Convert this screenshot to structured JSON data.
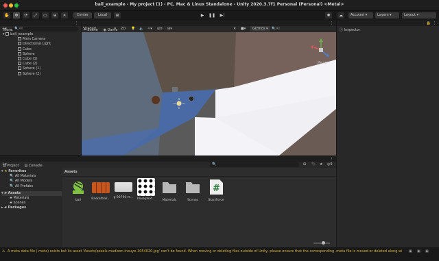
{
  "window": {
    "title": "ball_example - My project (1) - PC, Mac & Linux Standalone - Unity 2020.3.7f1 Personal (Personal) <Metal>"
  },
  "toolbar": {
    "center_label": "Center",
    "local_label": "Local",
    "account_label": "Account",
    "layers_label": "Layers",
    "layout_label": "Layout"
  },
  "hierarchy": {
    "tab": "Hierarchy",
    "search_placeholder": "All",
    "root": "ball_example",
    "items": [
      "Main Camera",
      "Directional Light",
      "Cube",
      "Sphere",
      "Cube (1)",
      "Cube (2)",
      "Sphere (1)",
      "Sphere (2)"
    ]
  },
  "scene": {
    "tab_scene": "Scene",
    "tab_game": "Game",
    "shading": "Shaded",
    "mode_2d": "2D",
    "gizmos": "Gizmos",
    "fx_count": "0",
    "gizmo_label": "Persp",
    "search_placeholder": "All"
  },
  "inspector": {
    "tab": "Inspector"
  },
  "project": {
    "tab_project": "Project",
    "tab_console": "Console",
    "favorites_label": "Favorites",
    "favorites": [
      "All Materials",
      "All Models",
      "All Prefabs"
    ],
    "assets_label": "Assets",
    "asset_folders": [
      "Materials",
      "Scenes"
    ],
    "packages_label": "Packages",
    "breadcrumb": "Assets",
    "hidden_count": "9",
    "assets": [
      {
        "name": "ball"
      },
      {
        "name": "Basketball..."
      },
      {
        "name": "g-90790-m..."
      },
      {
        "name": "blockphot..."
      },
      {
        "name": "Materials"
      },
      {
        "name": "Scenes"
      },
      {
        "name": "StartForce"
      }
    ]
  },
  "status": {
    "message": "A meta data file (.meta) exists but its asset 'Assets/pexels-madison-inouye-1054020.jpg' can't be found. When moving or deleting files outside of Unity, please ensure that the corresponding .meta file is moved or deleted along with"
  }
}
